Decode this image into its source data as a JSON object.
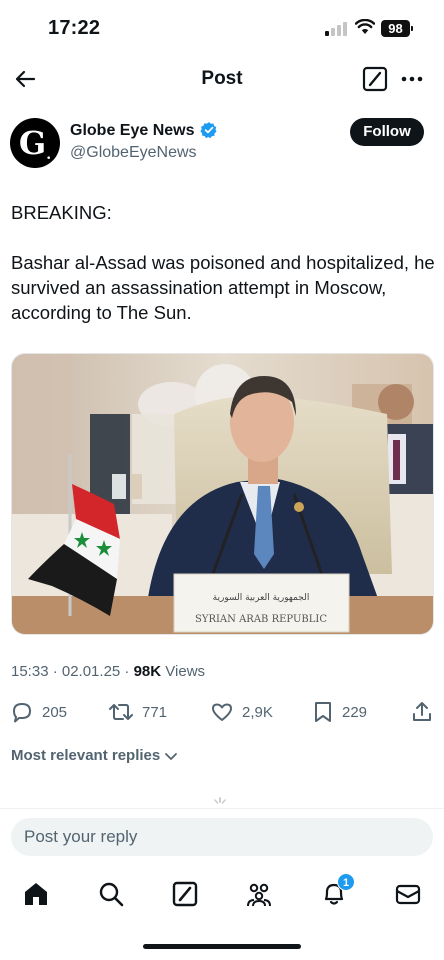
{
  "status_bar": {
    "time": "17:22",
    "battery": "98"
  },
  "header": {
    "title": "Post"
  },
  "author": {
    "name": "Globe Eye News",
    "handle": "@GlobeEyeNews",
    "avatar_text": "G",
    "follow_label": "Follow"
  },
  "tweet": {
    "paragraphs": [
      "BREAKING:",
      "Bashar al-Assad was poisoned and hospitalized, he survived an assassination attempt in Moscow, according to The Sun."
    ],
    "image": {
      "nameplate_line1": "الجمهورية العربية السورية",
      "nameplate_line2": "SYRIAN ARAB REPUBLIC"
    }
  },
  "meta": {
    "time_date": "15:33 · 02.01.25 · ",
    "views_count": "98K",
    "views_label": " Views"
  },
  "actions": {
    "replies": "205",
    "reposts": "771",
    "likes": "2,9K",
    "bookmarks": "229"
  },
  "replies_filter": {
    "label": "Most relevant replies"
  },
  "composer": {
    "placeholder": "Post your reply"
  },
  "nav": {
    "notifications_badge": "1"
  },
  "colors": {
    "accent": "#1d9bf0",
    "text": "#0f1419",
    "secondary": "#536471"
  }
}
